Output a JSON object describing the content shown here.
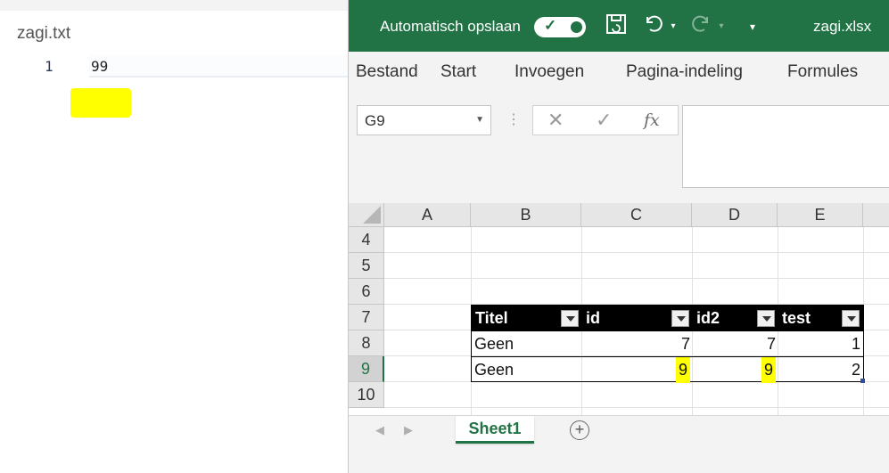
{
  "editor": {
    "tab_title": "zagi.txt",
    "line_number": "1",
    "line_content": "99",
    "highlight_color": "#ffff00"
  },
  "excel": {
    "accent_color": "#217346",
    "titlebar": {
      "autosave_label": "Automatisch opslaan",
      "autosave_on": true,
      "file_name": "zagi.xlsx",
      "icons": [
        "save-icon",
        "undo-icon",
        "redo-icon",
        "customize-qat-icon"
      ]
    },
    "ribbon_tabs": [
      "Bestand",
      "Start",
      "Invoegen",
      "Pagina-indeling",
      "Formules"
    ],
    "name_box": "G9",
    "formula_value": "",
    "columns": [
      "A",
      "B",
      "C",
      "D",
      "E"
    ],
    "rows": [
      "4",
      "5",
      "6",
      "7",
      "8",
      "9",
      "10"
    ],
    "active_row": "9",
    "table": {
      "headers": [
        "Titel",
        "id",
        "id2",
        "test"
      ],
      "rows": [
        [
          "Geen",
          "7",
          "7",
          "1"
        ],
        [
          "Geen",
          "9",
          "9",
          "2"
        ]
      ],
      "highlighted_cells": [
        "C9",
        "D9"
      ]
    },
    "sheet_tab": "Sheet1",
    "add_sheet_symbol": "+"
  }
}
